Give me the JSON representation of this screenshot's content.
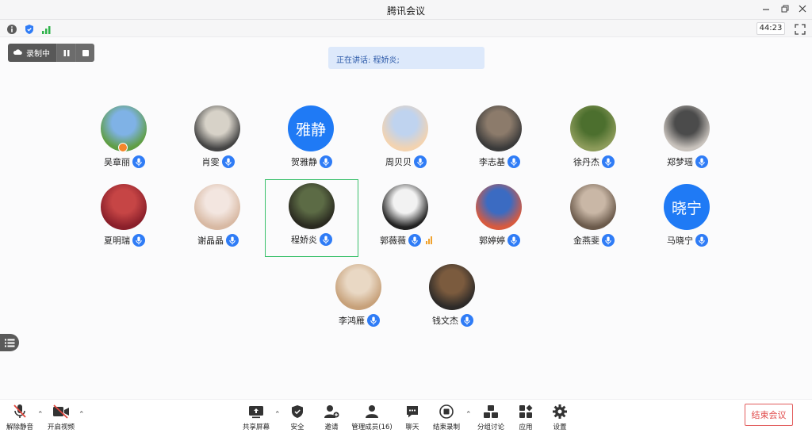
{
  "window": {
    "title": "腾讯会议"
  },
  "infobar": {
    "timer": "44:23"
  },
  "recording": {
    "label": "录制中"
  },
  "speaking": {
    "text": "正在讲话: 程娇炎;"
  },
  "participants": [
    {
      "name": "吴章丽",
      "avatar_colors": [
        "#7fb2e6",
        "#5f9e44"
      ]
    },
    {
      "name": "肖雯",
      "avatar_colors": [
        "#d7d2c8",
        "#444"
      ]
    },
    {
      "name": "贺雅静",
      "avatar_text": "雅静"
    },
    {
      "name": "周贝贝",
      "avatar_colors": [
        "#bfd3ef",
        "#f3d3b0"
      ]
    },
    {
      "name": "李志基",
      "avatar_colors": [
        "#8c7b6b",
        "#3a3a3a"
      ]
    },
    {
      "name": "徐丹杰",
      "avatar_colors": [
        "#4c6f2e",
        "#8c9b5a"
      ]
    },
    {
      "name": "郑梦瑶",
      "avatar_colors": [
        "#4b4b4b",
        "#c9c3bd"
      ]
    },
    {
      "name": "夏明瑞",
      "avatar_colors": [
        "#c64545",
        "#8a1f2a"
      ]
    },
    {
      "name": "谢晶晶",
      "avatar_colors": [
        "#f3e6e0",
        "#d8b9a3"
      ]
    },
    {
      "name": "程娇炎",
      "avatar_colors": [
        "#5c6b45",
        "#2a2a20"
      ]
    },
    {
      "name": "郭薇薇",
      "avatar_colors": [
        "#f2f2f2",
        "#222222"
      ]
    },
    {
      "name": "郭婷婷",
      "avatar_colors": [
        "#3b6bc2",
        "#d85a3e"
      ]
    },
    {
      "name": "金燕斐",
      "avatar_colors": [
        "#c9b7a6",
        "#6b5a4b"
      ]
    },
    {
      "name": "马晓宁",
      "avatar_text": "晓宁"
    },
    {
      "name": "李鸿雁",
      "avatar_colors": [
        "#e9d8c4",
        "#c7a17a"
      ]
    },
    {
      "name": "钱文杰",
      "avatar_colors": [
        "#7b5b3e",
        "#2d2a28"
      ]
    }
  ],
  "toolbar": {
    "unmute": "解除静音",
    "start_video": "开启视频",
    "share_screen": "共享屏幕",
    "security": "安全",
    "invite": "邀请",
    "manage_members": "管理成员(16)",
    "chat": "聊天",
    "end_recording": "结束录制",
    "breakout": "分组讨论",
    "apps": "应用",
    "settings": "设置",
    "end_meeting": "结束会议"
  },
  "colors": {
    "accent": "#1f7af5",
    "active_border": "#3ac06b",
    "end_red": "#e14b4b"
  }
}
